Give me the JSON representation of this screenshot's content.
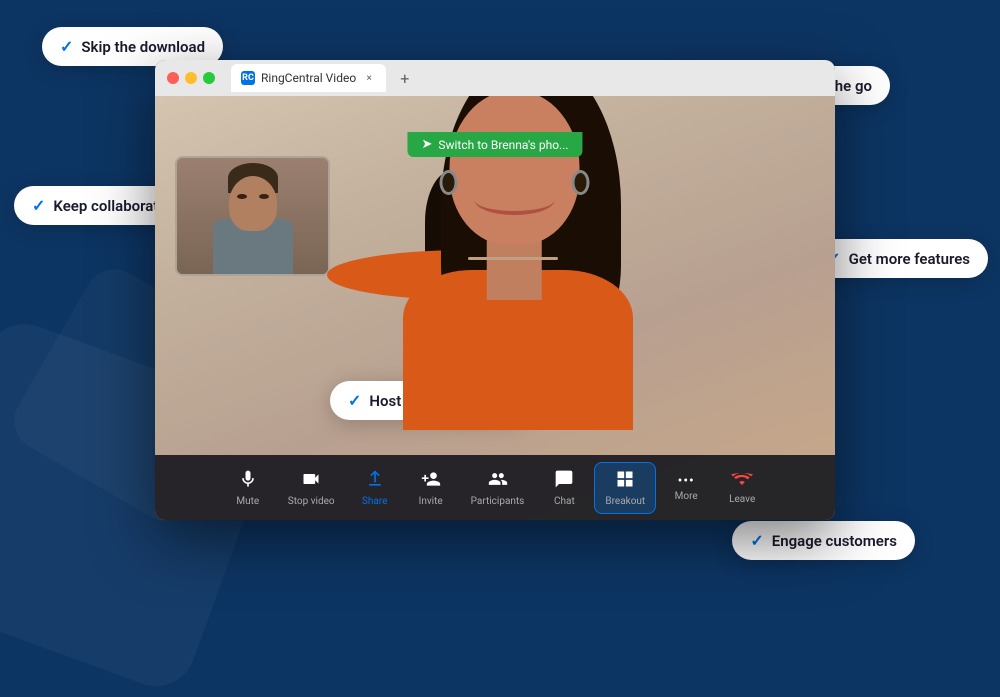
{
  "background": {
    "color": "#0d3563"
  },
  "browser": {
    "tab_label": "RingCentral Video",
    "tab_icon": "RC",
    "switch_banner": "Switch to Brenna's pho..."
  },
  "toolbar": {
    "items": [
      {
        "id": "mute",
        "label": "Mute",
        "icon": "🎤"
      },
      {
        "id": "stop-video",
        "label": "Stop video",
        "icon": "📷"
      },
      {
        "id": "share",
        "label": "Share",
        "icon": "⬆"
      },
      {
        "id": "invite",
        "label": "Invite",
        "icon": "👤"
      },
      {
        "id": "participants",
        "label": "Participants",
        "icon": "👥"
      },
      {
        "id": "chat",
        "label": "Chat",
        "icon": "💬"
      },
      {
        "id": "breakout",
        "label": "Breakout",
        "icon": "⊞"
      },
      {
        "id": "more",
        "label": "More",
        "icon": "•••"
      },
      {
        "id": "leave",
        "label": "Leave",
        "icon": "📞"
      }
    ]
  },
  "features": [
    {
      "id": "skip",
      "label": "Skip the download"
    },
    {
      "id": "switch",
      "label": "Switch devices on the go"
    },
    {
      "id": "keep",
      "label": "Keep collaborating"
    },
    {
      "id": "host",
      "label": "Host larger meetings"
    },
    {
      "id": "get",
      "label": "Get more features"
    },
    {
      "id": "engage",
      "label": "Engage customers"
    }
  ]
}
